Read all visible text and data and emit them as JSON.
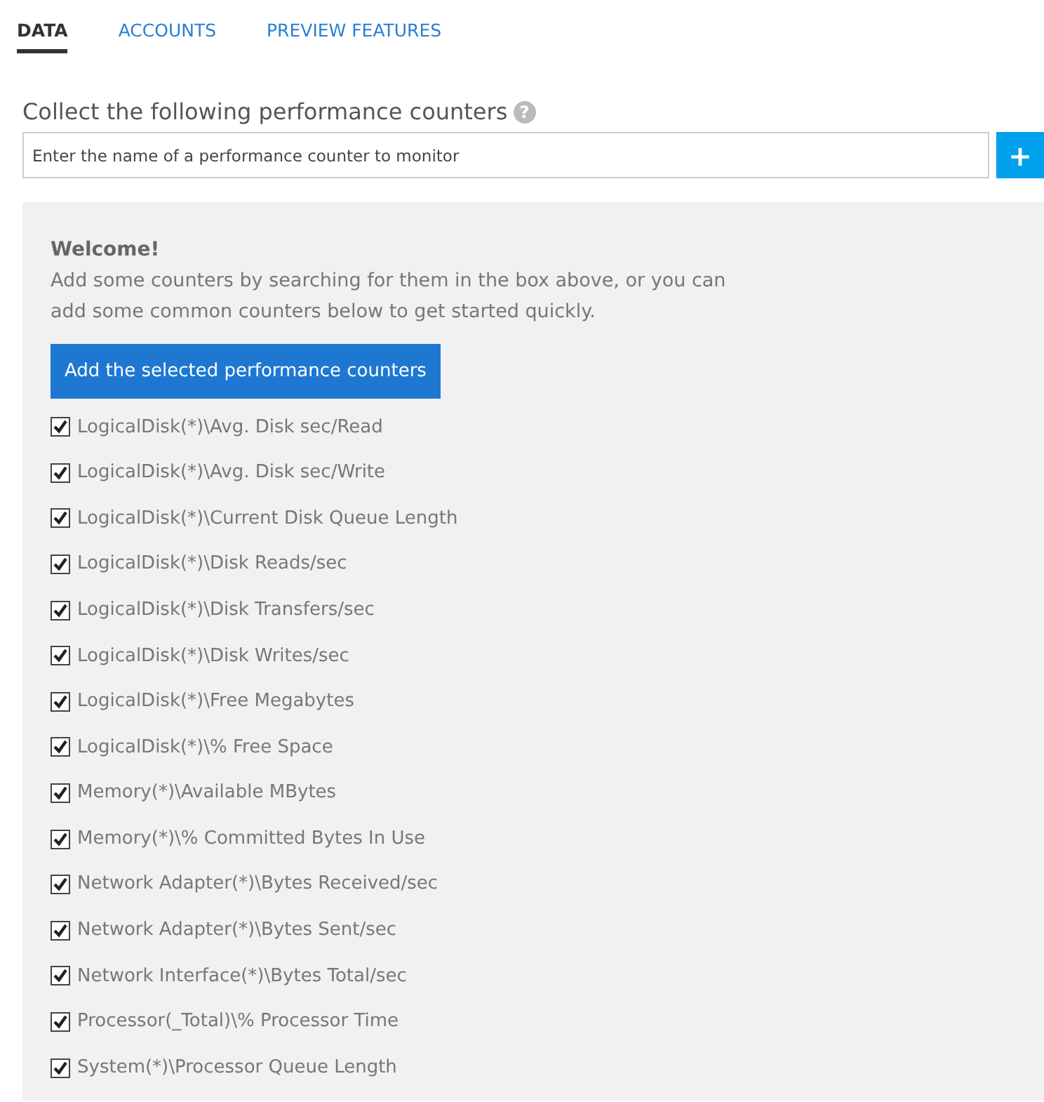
{
  "tabs": [
    {
      "label": "DATA",
      "selected": true
    },
    {
      "label": "ACCOUNTS",
      "selected": false
    },
    {
      "label": "PREVIEW FEATURES",
      "selected": false
    }
  ],
  "section": {
    "heading": "Collect the following performance counters",
    "help": "?"
  },
  "search": {
    "placeholder": "Enter the name of a performance counter to monitor",
    "add_button": "+"
  },
  "welcome": {
    "title": "Welcome!",
    "text_lines": [
      "Add some counters by searching for them in the box above, or you can",
      "add some common counters below to get started quickly."
    ],
    "button": "Add the selected performance counters"
  },
  "counters": [
    {
      "label": "LogicalDisk(*)\\Avg. Disk sec/Read",
      "checked": true
    },
    {
      "label": "LogicalDisk(*)\\Avg. Disk sec/Write",
      "checked": true
    },
    {
      "label": "LogicalDisk(*)\\Current Disk Queue Length",
      "checked": true
    },
    {
      "label": "LogicalDisk(*)\\Disk Reads/sec",
      "checked": true
    },
    {
      "label": "LogicalDisk(*)\\Disk Transfers/sec",
      "checked": true
    },
    {
      "label": "LogicalDisk(*)\\Disk Writes/sec",
      "checked": true
    },
    {
      "label": "LogicalDisk(*)\\Free Megabytes",
      "checked": true
    },
    {
      "label": "LogicalDisk(*)\\% Free Space",
      "checked": true
    },
    {
      "label": "Memory(*)\\Available MBytes",
      "checked": true
    },
    {
      "label": "Memory(*)\\% Committed Bytes In Use",
      "checked": true
    },
    {
      "label": "Network Adapter(*)\\Bytes Received/sec",
      "checked": true
    },
    {
      "label": "Network Adapter(*)\\Bytes Sent/sec",
      "checked": true
    },
    {
      "label": "Network Interface(*)\\Bytes Total/sec",
      "checked": true
    },
    {
      "label": "Processor(_Total)\\% Processor Time",
      "checked": true
    },
    {
      "label": "System(*)\\Processor Queue Length",
      "checked": true
    }
  ]
}
